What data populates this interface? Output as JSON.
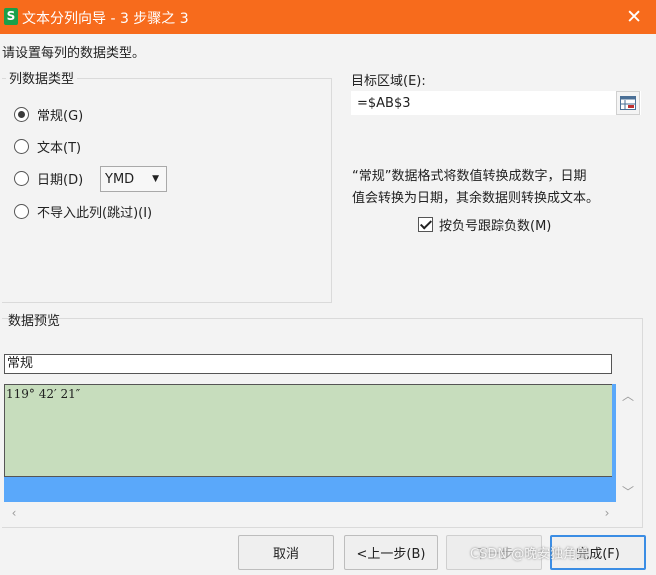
{
  "window": {
    "title": "文本分列向导 - 3 步骤之 3",
    "app_icon": "S",
    "close": "✕"
  },
  "instruction": "请设置每列的数据类型。",
  "column_type": {
    "legend": "列数据类型",
    "options": [
      {
        "label": "常规(G)",
        "checked": true
      },
      {
        "label": "文本(T)",
        "checked": false
      },
      {
        "label": "日期(D)",
        "checked": false
      },
      {
        "label": "不导入此列(跳过)(I)",
        "checked": false
      }
    ],
    "date_format": "YMD"
  },
  "target": {
    "label": "目标区域(E):",
    "value": "=$AB$3"
  },
  "description": {
    "line1": "“常规”数据格式将数值转换成数字，日期",
    "line2": "值会转换为日期，其余数据则转换成文本。"
  },
  "negative_checkbox": {
    "label": "按负号跟踪负数(M)",
    "checked": true
  },
  "preview": {
    "title": "数据预览",
    "column_header": "常规",
    "row_value": "119° 42′ 21″"
  },
  "buttons": {
    "cancel": "取消",
    "back": "<上一步(B)",
    "next": "下一步",
    "finish": "完成(F)"
  },
  "watermark": "CSDN @晚安独角兽",
  "colors": {
    "titlebar": "#f76b1c",
    "preview_green": "#c7ddbd",
    "selection_blue": "#5aa8fa"
  }
}
